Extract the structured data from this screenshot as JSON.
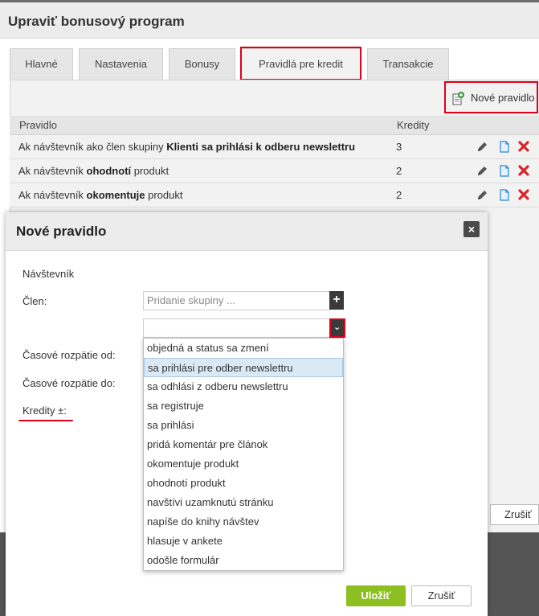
{
  "page": {
    "title": "Upraviť bonusový program"
  },
  "tabs": [
    {
      "label": "Hlavné"
    },
    {
      "label": "Nastavenia"
    },
    {
      "label": "Bonusy"
    },
    {
      "label": "Pravidlá pre kredit"
    },
    {
      "label": "Transakcie"
    }
  ],
  "toolbar": {
    "new_rule_label": "Nové pravidlo"
  },
  "table": {
    "headers": {
      "rule": "Pravidlo",
      "credits": "Kredity"
    },
    "rows": [
      {
        "prefix": "Ak návštevník ako člen skupiny ",
        "bold": "Klienti sa prihlási k odberu newslettru",
        "suffix": "",
        "credits": "3"
      },
      {
        "prefix": "Ak návštevník ",
        "bold": "ohodnotí",
        "suffix": " produkt",
        "credits": "2"
      },
      {
        "prefix": "Ak návštevník ",
        "bold": "okomentuje",
        "suffix": " produkt",
        "credits": "2"
      }
    ]
  },
  "background_cancel_label": "Zrušiť",
  "modal": {
    "title": "Nové pravidlo",
    "close_symbol": "×",
    "visitor_label": "Návštevník",
    "member_label": "Člen:",
    "group_placeholder": "Pridanie skupiny ...",
    "add_symbol": "+",
    "time_from_label": "Časové rozpätie od:",
    "time_to_label": "Časové rozpätie do:",
    "credits_label": "Kredity ±:",
    "action_options": [
      "objedná a status sa zmení",
      "sa prihlási pre odber newslettru",
      "sa odhlási z odberu newslettru",
      "sa registruje",
      "sa prihlási",
      "pridá komentár pre článok",
      "okomentuje produkt",
      "ohodnotí produkt",
      "navštívi uzamknutú stránku",
      "napíše do knihy návštev",
      "hlasuje v ankete",
      "odošle formulár"
    ],
    "highlighted_option": "sa prihlási pre odber newslettru",
    "save_label": "Uložiť",
    "cancel_label": "Zrušiť"
  },
  "colors": {
    "accent_red": "#e0001a",
    "save_green": "#8cbf1f",
    "icon_green": "#3a9a3a",
    "delete_red": "#d9262b"
  }
}
